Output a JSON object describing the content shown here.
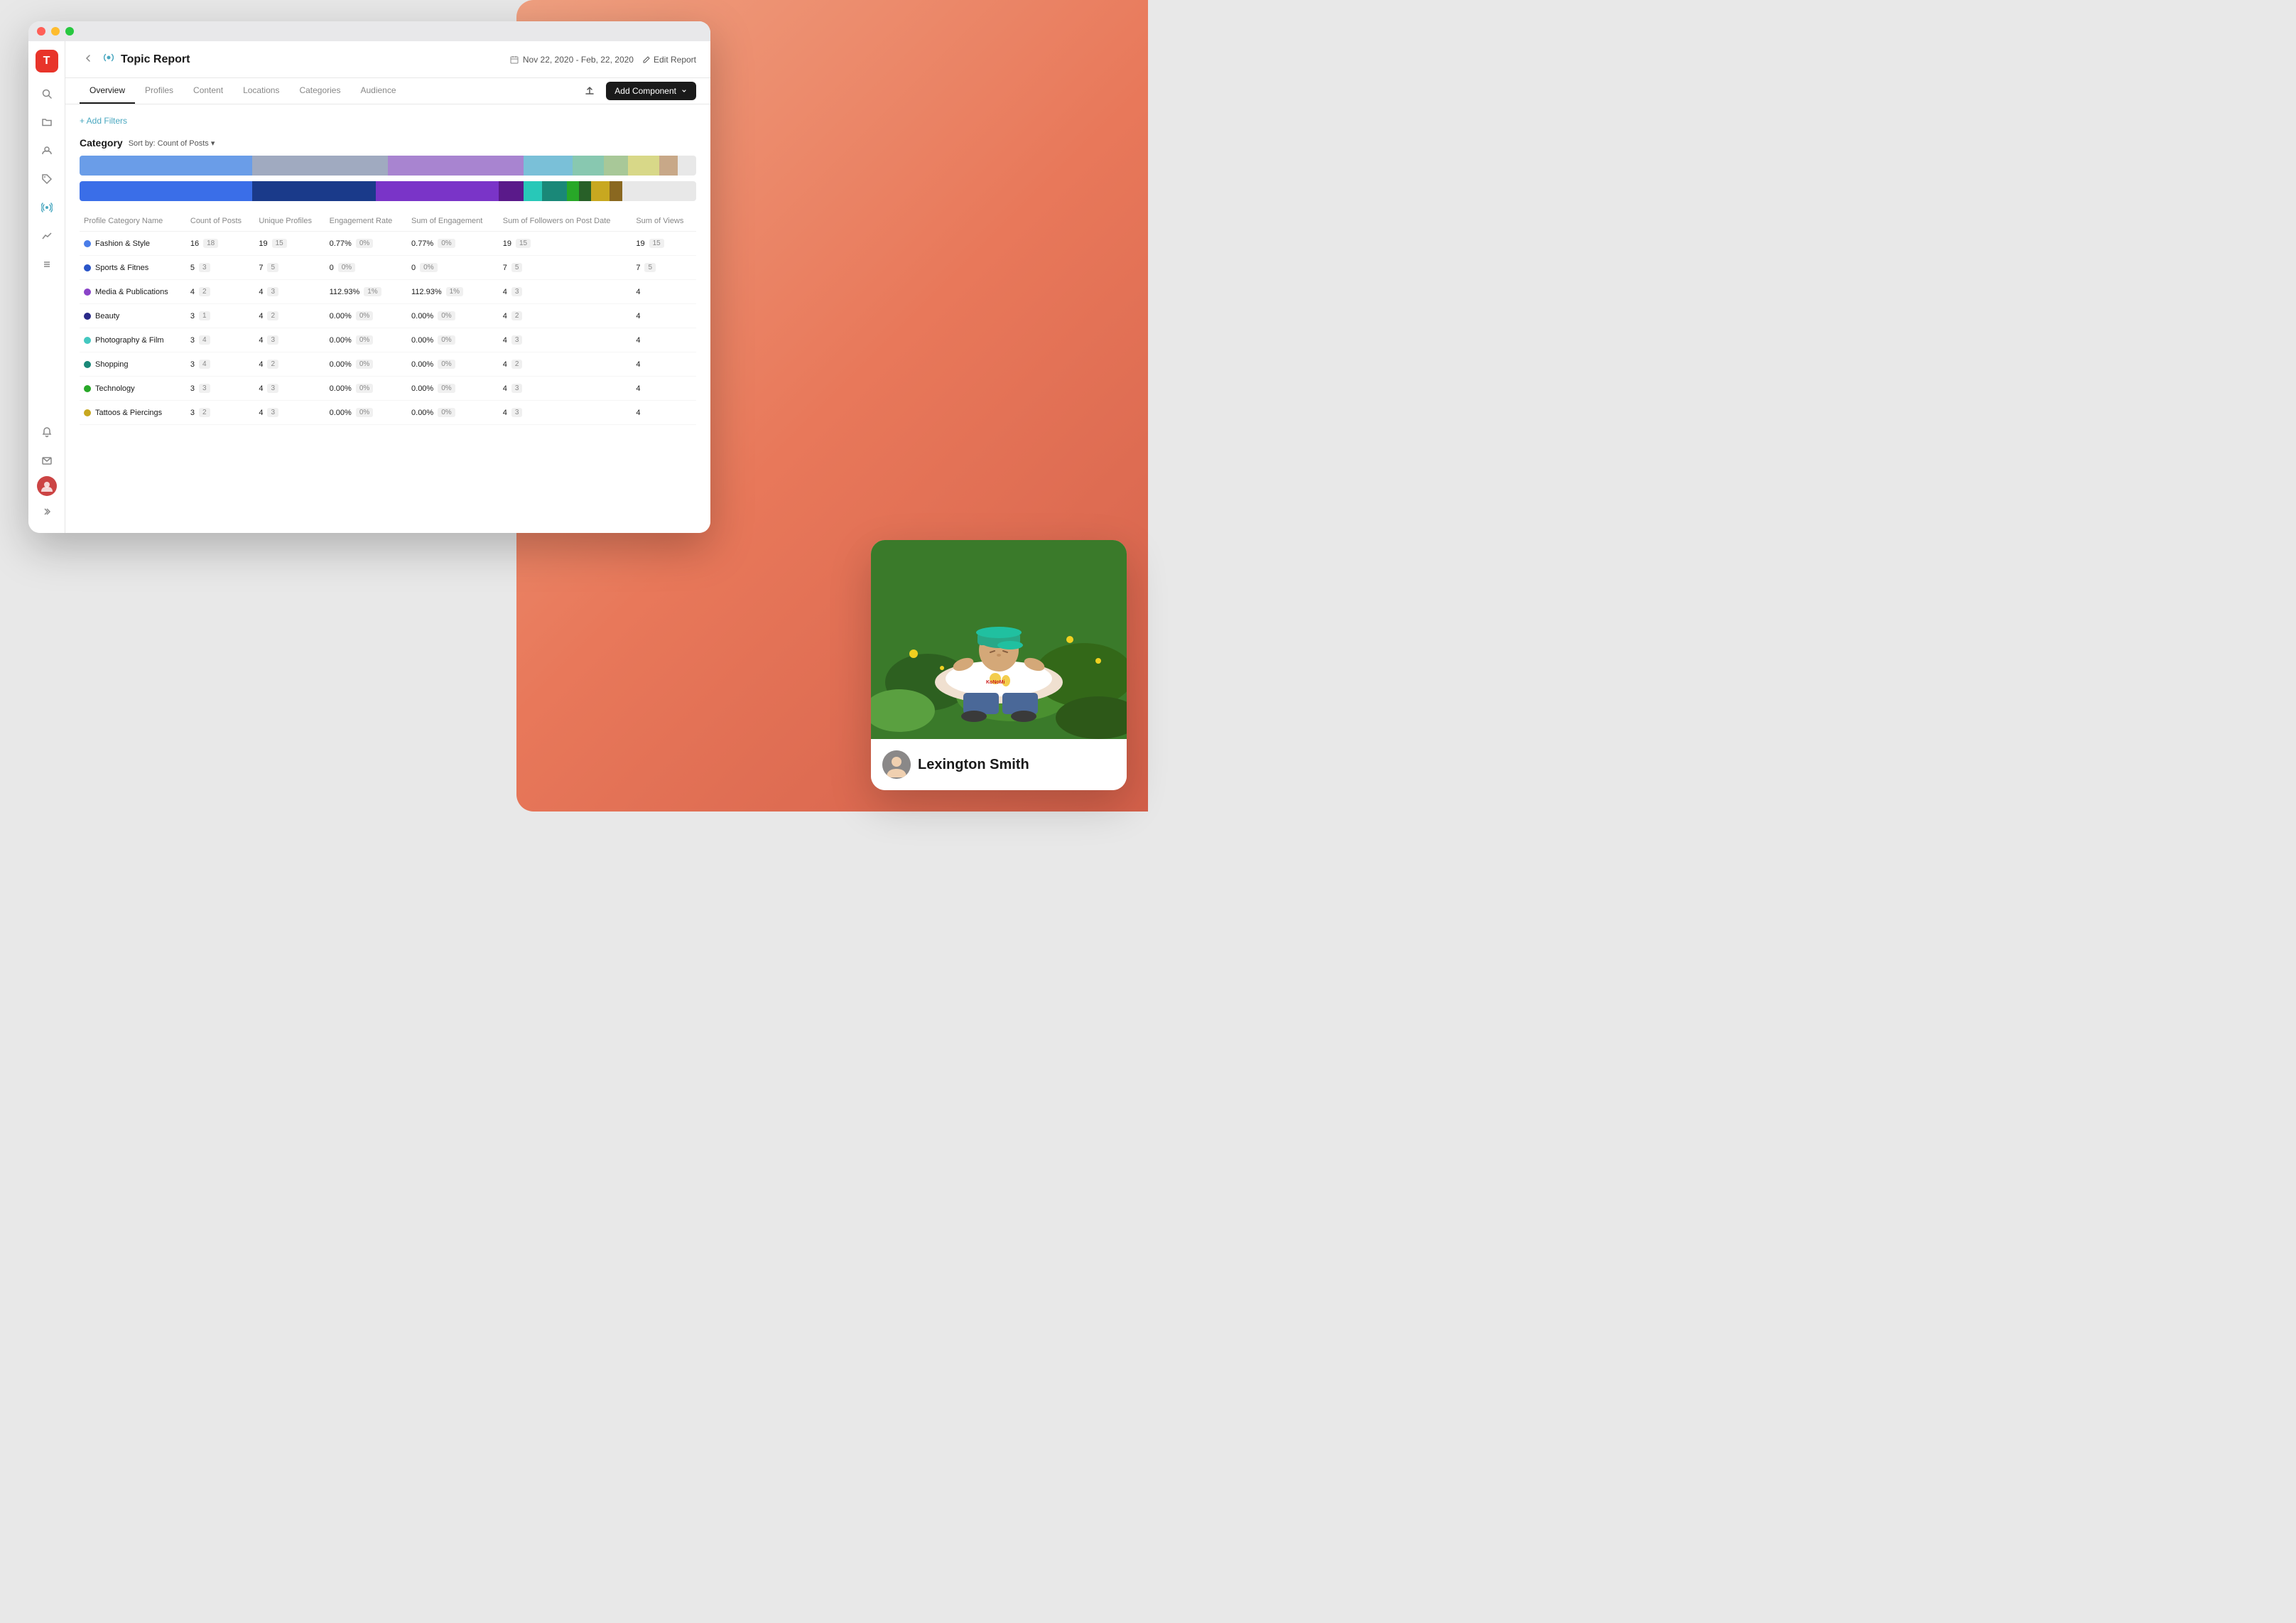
{
  "window": {
    "title": "Topic Report"
  },
  "header": {
    "back_label": "←",
    "icon_label": "📡",
    "title": "Topic Report",
    "date_range": "Nov 22, 2020 - Feb, 22, 2020",
    "edit_report_label": "Edit Report"
  },
  "tabs": [
    {
      "label": "Overview",
      "active": true
    },
    {
      "label": "Profiles",
      "active": false
    },
    {
      "label": "Content",
      "active": false
    },
    {
      "label": "Locations",
      "active": false
    },
    {
      "label": "Categories",
      "active": false
    },
    {
      "label": "Audience",
      "active": false
    }
  ],
  "toolbar": {
    "add_component_label": "Add Component"
  },
  "filters": {
    "add_label": "+ Add Filters"
  },
  "category_section": {
    "title": "Category",
    "sort_label": "Sort by: Count of Posts ▾"
  },
  "bar_chart_top": [
    {
      "color": "#6a9de8",
      "width": 28
    },
    {
      "color": "#a0aac0",
      "width": 22
    },
    {
      "color": "#a884d0",
      "width": 22
    },
    {
      "color": "#7ac0d8",
      "width": 8
    },
    {
      "color": "#88c8b0",
      "width": 5
    },
    {
      "color": "#a8c898",
      "width": 4
    },
    {
      "color": "#d8d888",
      "width": 5
    },
    {
      "color": "#c8a888",
      "width": 3
    },
    {
      "color": "#e0e0e0",
      "width": 3
    }
  ],
  "bar_chart_bottom": [
    {
      "color": "#3a6ee8",
      "width": 28
    },
    {
      "color": "#1a3a8a",
      "width": 20
    },
    {
      "color": "#7a34c8",
      "width": 20
    },
    {
      "color": "#5a1a8a",
      "width": 4
    },
    {
      "color": "#28c8b8",
      "width": 3
    },
    {
      "color": "#1a8878",
      "width": 4
    },
    {
      "color": "#28a828",
      "width": 2
    },
    {
      "color": "#286028",
      "width": 2
    },
    {
      "color": "#c8a820",
      "width": 3
    },
    {
      "color": "#8a6820",
      "width": 2
    },
    {
      "color": "#e0e0e0",
      "width": 12
    }
  ],
  "table": {
    "columns": [
      "Profile Category Name",
      "Count of Posts",
      "Unique Profiles",
      "Engagement Rate",
      "Sum of Engagement",
      "Sum of Followers on Post Date",
      "Sum of Views"
    ],
    "rows": [
      {
        "name": "Fashion & Style",
        "dot_color": "#4a7de8",
        "count_posts_main": "16",
        "count_posts_badge": "18",
        "unique_profiles_main": "19",
        "unique_profiles_badge": "15",
        "engagement_rate_main": "0.77%",
        "engagement_rate_badge": "0%",
        "sum_engagement_main": "0.77%",
        "sum_engagement_badge": "0%",
        "sum_followers_main": "19",
        "sum_followers_badge": "15",
        "sum_views_main": "19",
        "sum_views_badge": "15"
      },
      {
        "name": "Sports & Fitnes",
        "dot_color": "#2a55c8",
        "count_posts_main": "5",
        "count_posts_badge": "3",
        "unique_profiles_main": "7",
        "unique_profiles_badge": "5",
        "engagement_rate_main": "0",
        "engagement_rate_badge": "0%",
        "sum_engagement_main": "0",
        "sum_engagement_badge": "0%",
        "sum_followers_main": "7",
        "sum_followers_badge": "5",
        "sum_views_main": "7",
        "sum_views_badge": "5"
      },
      {
        "name": "Media & Publications",
        "dot_color": "#8a44c8",
        "count_posts_main": "4",
        "count_posts_badge": "2",
        "unique_profiles_main": "4",
        "unique_profiles_badge": "3",
        "engagement_rate_main": "112.93%",
        "engagement_rate_badge": "1%",
        "sum_engagement_main": "112.93%",
        "sum_engagement_badge": "1%",
        "sum_followers_main": "4",
        "sum_followers_badge": "3",
        "sum_views_main": "4",
        "sum_views_badge": ""
      },
      {
        "name": "Beauty",
        "dot_color": "#2a2a88",
        "count_posts_main": "3",
        "count_posts_badge": "1",
        "unique_profiles_main": "4",
        "unique_profiles_badge": "2",
        "engagement_rate_main": "0.00%",
        "engagement_rate_badge": "0%",
        "sum_engagement_main": "0.00%",
        "sum_engagement_badge": "0%",
        "sum_followers_main": "4",
        "sum_followers_badge": "2",
        "sum_views_main": "4",
        "sum_views_badge": ""
      },
      {
        "name": "Photography & Film",
        "dot_color": "#44c8c0",
        "count_posts_main": "3",
        "count_posts_badge": "4",
        "unique_profiles_main": "4",
        "unique_profiles_badge": "3",
        "engagement_rate_main": "0.00%",
        "engagement_rate_badge": "0%",
        "sum_engagement_main": "0.00%",
        "sum_engagement_badge": "0%",
        "sum_followers_main": "4",
        "sum_followers_badge": "3",
        "sum_views_main": "4",
        "sum_views_badge": ""
      },
      {
        "name": "Shopping",
        "dot_color": "#1a8878",
        "count_posts_main": "3",
        "count_posts_badge": "4",
        "unique_profiles_main": "4",
        "unique_profiles_badge": "2",
        "engagement_rate_main": "0.00%",
        "engagement_rate_badge": "0%",
        "sum_engagement_main": "0.00%",
        "sum_engagement_badge": "0%",
        "sum_followers_main": "4",
        "sum_followers_badge": "2",
        "sum_views_main": "4",
        "sum_views_badge": ""
      },
      {
        "name": "Technology",
        "dot_color": "#28a828",
        "count_posts_main": "3",
        "count_posts_badge": "3",
        "unique_profiles_main": "4",
        "unique_profiles_badge": "3",
        "engagement_rate_main": "0.00%",
        "engagement_rate_badge": "0%",
        "sum_engagement_main": "0.00%",
        "sum_engagement_badge": "0%",
        "sum_followers_main": "4",
        "sum_followers_badge": "3",
        "sum_views_main": "4",
        "sum_views_badge": ""
      },
      {
        "name": "Tattoos & Piercings",
        "dot_color": "#c8a820",
        "count_posts_main": "3",
        "count_posts_badge": "2",
        "unique_profiles_main": "4",
        "unique_profiles_badge": "3",
        "engagement_rate_main": "0.00%",
        "engagement_rate_badge": "0%",
        "sum_engagement_main": "0.00%",
        "sum_engagement_badge": "0%",
        "sum_followers_main": "4",
        "sum_followers_badge": "3",
        "sum_views_main": "4",
        "sum_views_badge": ""
      }
    ]
  },
  "profile_card": {
    "name": "Lexington Smith",
    "image_alt": "Person lying on grass"
  },
  "sidebar": {
    "logo": "T",
    "icons": [
      {
        "name": "search",
        "symbol": "🔍"
      },
      {
        "name": "folder",
        "symbol": "📁"
      },
      {
        "name": "user",
        "symbol": "👤"
      },
      {
        "name": "tag",
        "symbol": "🏷"
      },
      {
        "name": "signal",
        "symbol": "📡"
      },
      {
        "name": "chart",
        "symbol": "📈"
      },
      {
        "name": "tools",
        "symbol": "🔧"
      }
    ],
    "bottom_icons": [
      {
        "name": "bell",
        "symbol": "🔔"
      },
      {
        "name": "mail",
        "symbol": "✉️"
      },
      {
        "name": "more",
        "symbol": ">>"
      }
    ]
  }
}
